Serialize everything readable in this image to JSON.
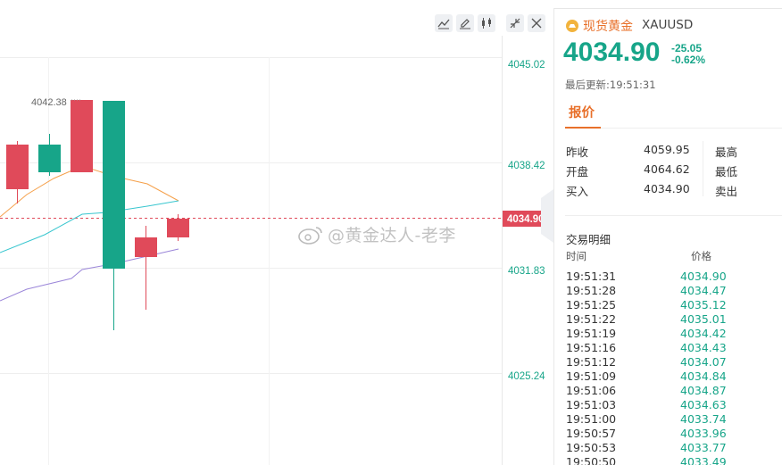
{
  "chart": {
    "price_labels": [
      "4045.02",
      "4038.42",
      "4031.83",
      "4025.24"
    ],
    "current_price_tag": "4034.90",
    "high_annotation": "4042.38",
    "colors": {
      "up": "#e04a5a",
      "down": "#17a589",
      "ma_orange": "#f5a04a",
      "ma_cyan": "#38c6cf",
      "ma_purple": "#9b86d9"
    }
  },
  "toolbar": {
    "icons": [
      "line-chart-icon",
      "pencil-icon",
      "candlestick-icon",
      "collapse-icon",
      "close-icon"
    ]
  },
  "quote": {
    "name": "现货黄金",
    "symbol": "XAUUSD",
    "price": "4034.90",
    "change": "-25.05",
    "change_pct": "-0.62%",
    "updated": "最后更新:19:51:31"
  },
  "tab": {
    "label": "报价"
  },
  "stats": {
    "prev_close_label": "昨收",
    "prev_close": "4059.95",
    "high_label": "最高",
    "open_label": "开盘",
    "open": "4064.62",
    "low_label": "最低",
    "bid_label": "买入",
    "bid": "4034.90",
    "ask_label": "卖出"
  },
  "trades": {
    "title": "交易明细",
    "col_time": "时间",
    "col_price": "价格",
    "rows": [
      {
        "time": "19:51:31",
        "price": "4034.90"
      },
      {
        "time": "19:51:28",
        "price": "4034.47"
      },
      {
        "time": "19:51:25",
        "price": "4035.12"
      },
      {
        "time": "19:51:22",
        "price": "4035.01"
      },
      {
        "time": "19:51:19",
        "price": "4034.42"
      },
      {
        "time": "19:51:16",
        "price": "4034.43"
      },
      {
        "time": "19:51:12",
        "price": "4034.07"
      },
      {
        "time": "19:51:09",
        "price": "4034.84"
      },
      {
        "time": "19:51:06",
        "price": "4034.87"
      },
      {
        "time": "19:51:03",
        "price": "4034.63"
      },
      {
        "time": "19:51:00",
        "price": "4033.74"
      },
      {
        "time": "19:50:57",
        "price": "4033.96"
      },
      {
        "time": "19:50:53",
        "price": "4033.77"
      },
      {
        "time": "19:50:50",
        "price": "4033.49"
      }
    ]
  },
  "watermark": "@黄金达人-老李"
}
